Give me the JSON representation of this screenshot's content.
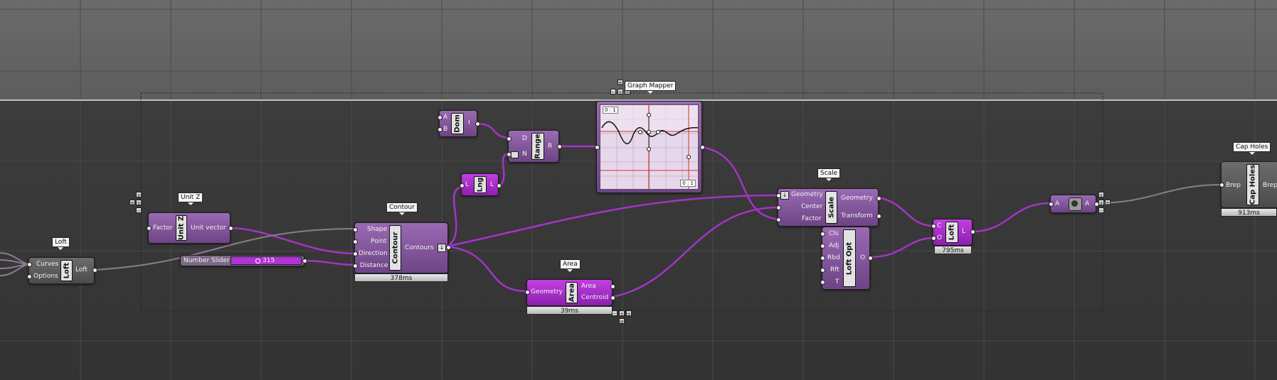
{
  "tags": {
    "loft1": "Loft",
    "unitz": "Unit Z",
    "contour": "Contour",
    "graph": "Graph Mapper",
    "area": "Area",
    "scale": "Scale",
    "capholes": "Cap Holes"
  },
  "components": {
    "loft1": {
      "inputs": [
        "Curves",
        "Options"
      ],
      "name": "Loft",
      "output": "Loft"
    },
    "unitz": {
      "input": "Factor",
      "name": "Unit Z",
      "output": "Unit vector"
    },
    "slider": {
      "label": "Number Slider",
      "value": "315"
    },
    "contour": {
      "inputs": [
        "Shape",
        "Point",
        "Direction",
        "Distance"
      ],
      "name": "Contour",
      "output": "Contours",
      "time": "378ms"
    },
    "dom": {
      "inputs": [
        "A",
        "B"
      ],
      "name": "Dom",
      "output": "I"
    },
    "range": {
      "inputs": [
        "D",
        "N"
      ],
      "name": "Range",
      "output": "R"
    },
    "lng": {
      "input": "L",
      "name": "Lng",
      "output": "L"
    },
    "graph": {
      "label_top": "0 : 1",
      "label_bottom": "0 : 1"
    },
    "area": {
      "input": "Geometry",
      "name": "Area",
      "outputs": [
        "Area",
        "Centroid"
      ],
      "time": "39ms"
    },
    "scale": {
      "inputs": [
        "Geometry",
        "Center",
        "Factor"
      ],
      "name": "Scale",
      "outputs": [
        "Geometry",
        "Transform"
      ]
    },
    "loftopt": {
      "inputs": [
        "Cls",
        "Adj",
        "Rbd",
        "Rft",
        "T"
      ],
      "name": "Loft Opt",
      "output": "O"
    },
    "loft2": {
      "inputs": [
        "C",
        "O"
      ],
      "name": "Loft",
      "output": "L",
      "time": "795ms"
    },
    "relay": {
      "input": "A",
      "output": "A"
    },
    "capholes": {
      "input": "Brep",
      "name": "Cap Holes",
      "output": "Brep",
      "time": "913ms"
    }
  },
  "colors": {
    "wire": "#a533c9",
    "wire_grey": "#8a7c92",
    "component_purple": "#8a5aa3",
    "component_magenta": "#b030d6",
    "component_grey": "#5a5a5a"
  }
}
